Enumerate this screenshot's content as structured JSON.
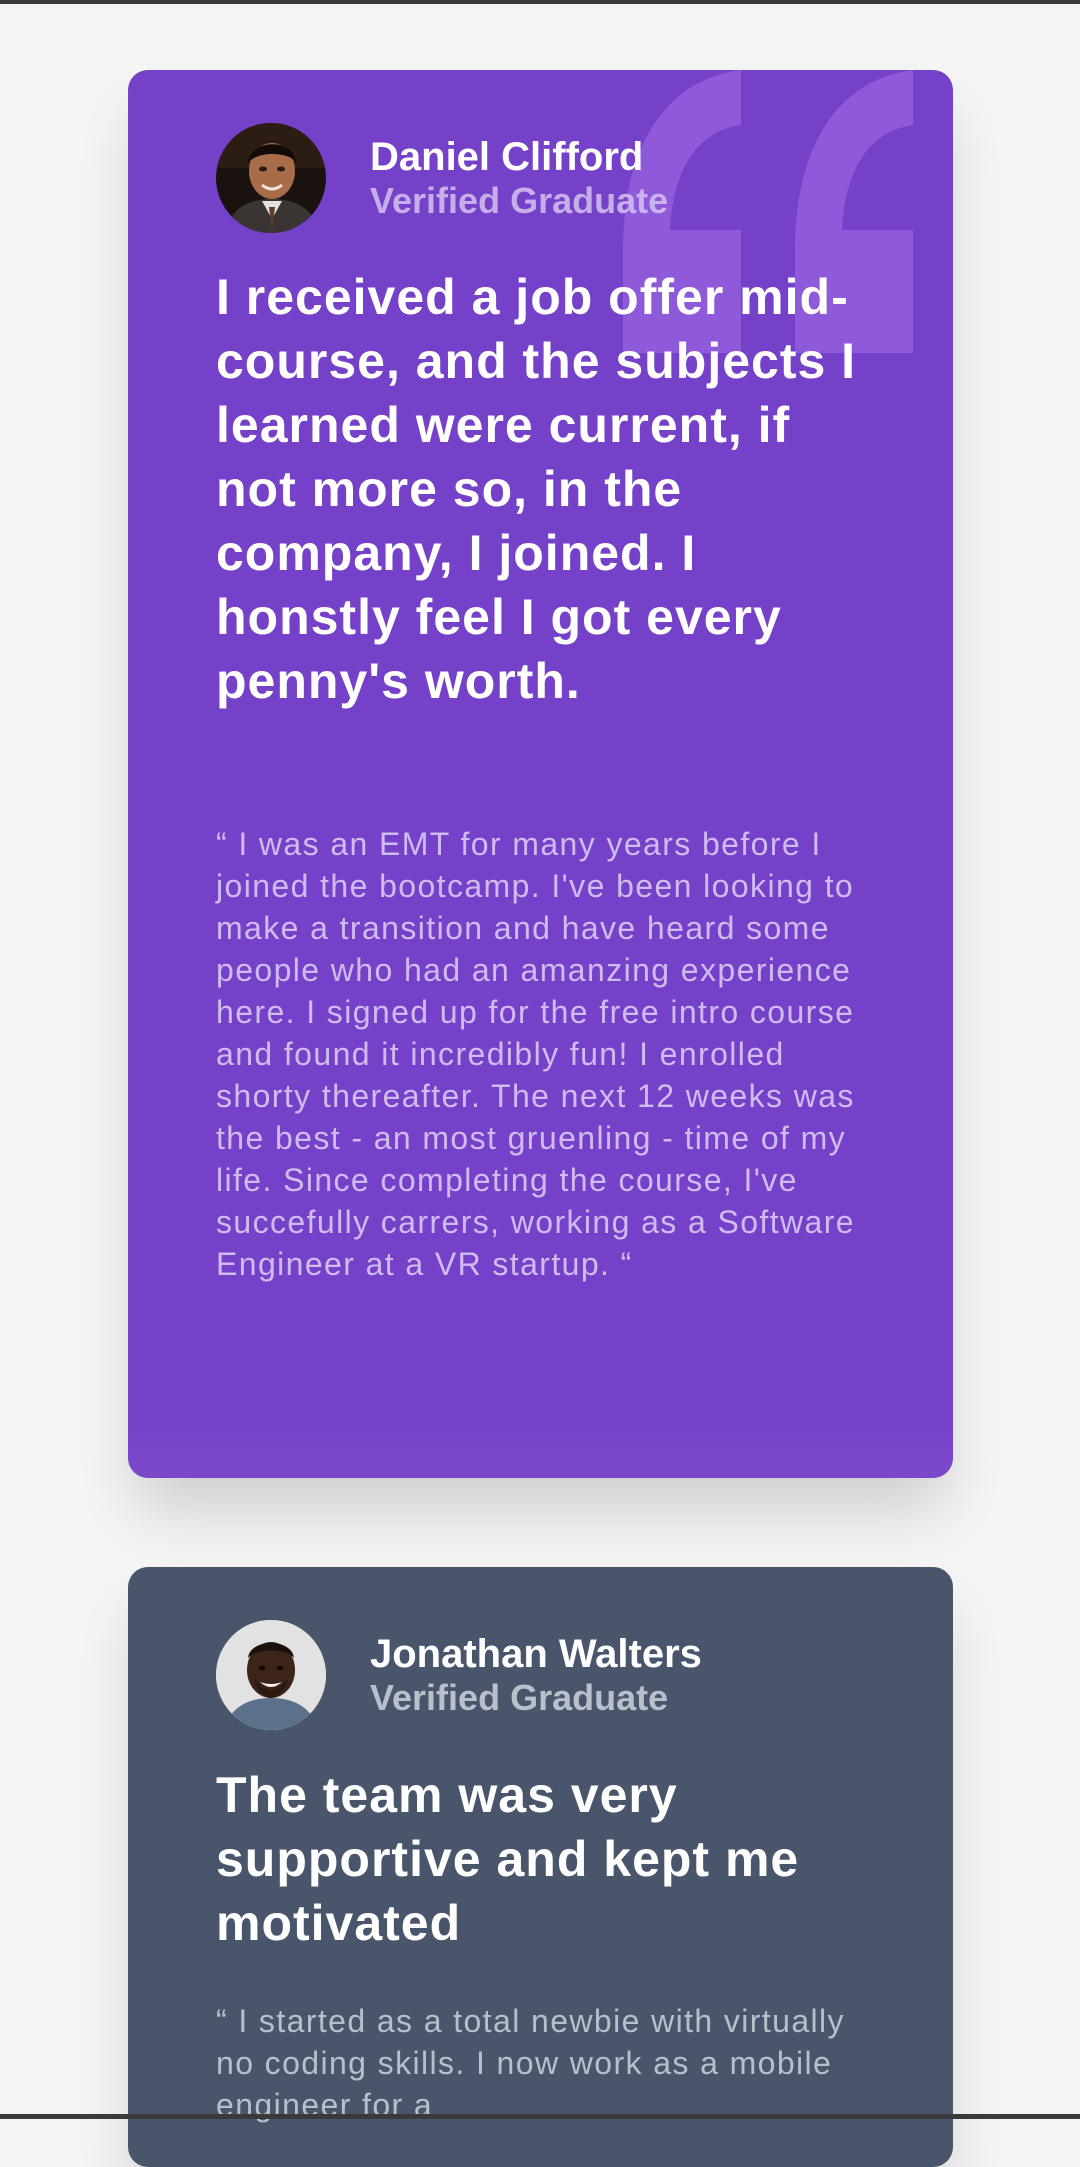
{
  "colors": {
    "page_background": "#f4f4f4",
    "card_purple": "#7541c8",
    "card_slate": "#48556a",
    "quote_mark": "#8e5ad9"
  },
  "testimonials": [
    {
      "name": "Daniel Clifford",
      "status": "Verified Graduate",
      "headline": "I received a job offer mid-course, and the subjects I learned were current, if not more so, in the company, I joined. I honstly feel I got every penny's worth.",
      "body": "“ I was an EMT for many years before I joined the bootcamp. I've been looking to make a transition and have heard some people who had an amanzing experience here. I signed up for the free intro course and found it incredibly fun! I enrolled shorty thereafter. The next 12 weeks was the best - an most gruenling - time of my life. Since completing the course, I've succefully carrers, working as a Software Engineer at a VR startup. “",
      "avatar_icon": "person-photo-icon",
      "decoration_icon": "quotation-mark-icon"
    },
    {
      "name": "Jonathan Walters",
      "status": "Verified Graduate",
      "headline": "The team was very supportive and kept me motivated",
      "body": "“ I started as a total newbie with virtually no coding skills. I now work as a mobile engineer for a",
      "avatar_icon": "person-photo-icon"
    }
  ]
}
